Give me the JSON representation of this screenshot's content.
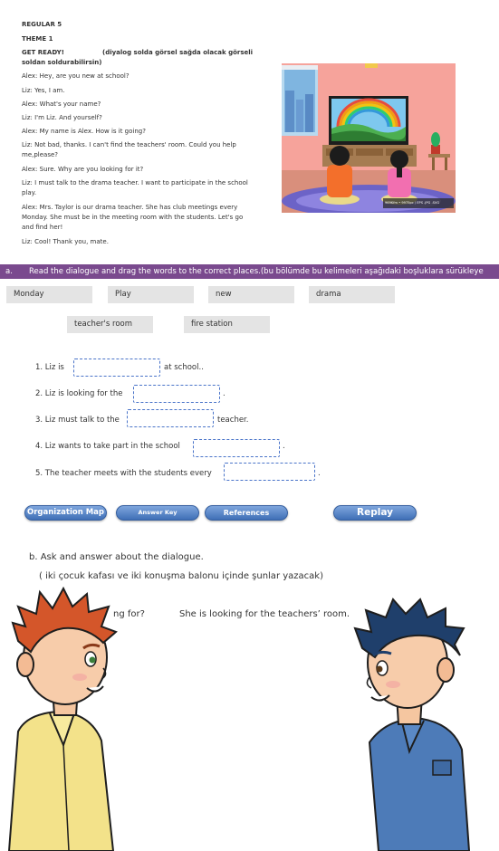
{
  "header": {
    "level": "REGULAR 5",
    "theme": "THEME 1",
    "get_ready": "GET READY!",
    "note_line1": "(diyalog solda görsel sağda olacak görseli",
    "note_line2": "soldan soldurabilirsin)"
  },
  "dialogue": [
    "Alex: Hey, are you new at school?",
    "Liz: Yes, I am.",
    "Alex: What's your name?",
    "Liz: I'm Liz. And yourself?",
    "Alex: My name is Alex. How is it going?",
    "Liz: Not bad, thanks. I can't find the teachers' room. Could you help",
    "me,please?",
    "Alex: Sure. Why are you looking for it?",
    "Liz: I must talk to the drama teacher. I want to participate in the school",
    "play.",
    "Alex: Mrs. Taylor is our drama teacher. She has club meetings every",
    "Monday. She must be in the meeting room with the students. Let's go",
    "and find her!",
    "Liz: Cool! Thank you, mate."
  ],
  "image_watermark": "969Kfm • 9975pc / EPS .JPG .SVG",
  "task_a": {
    "label": "a.",
    "instruction": "Read the dialogue and drag the words to the correct places.(bu bölümde bu kelimeleri aşağıdaki boşluklara sürükleye"
  },
  "word_bank": [
    "Monday",
    "Play",
    "new",
    "drama",
    "teacher's room",
    "fire station"
  ],
  "questions": {
    "q1_before": "1.  Liz is",
    "q1_after": "at school..",
    "q2_before": "2. Liz is looking for the",
    "q2_after": ".",
    "q3_before": "3. Liz must talk to the",
    "q3_after": "teacher.",
    "q4_before": "4. Liz wants to take part in the school",
    "q4_after": ".",
    "q5_before": "5. The teacher meets with the students every",
    "q5_after": "."
  },
  "buttons": {
    "organization_map": "Organization Map",
    "answer_key": "Answer Key",
    "references": "References",
    "replay": "Replay"
  },
  "task_b": {
    "title": "b. Ask and answer about the dialogue.",
    "note": "( iki çocuk kafası ve iki konuşma balonu içinde şunlar yazacak)",
    "question_fragment": "ng for?",
    "answer": "She is looking for the teachers’ room."
  },
  "colors": {
    "task_bar": "#7a4a8e",
    "button": "#4f7fc4",
    "slot_border": "#4a74c9",
    "chip": "#e4e4e4"
  }
}
